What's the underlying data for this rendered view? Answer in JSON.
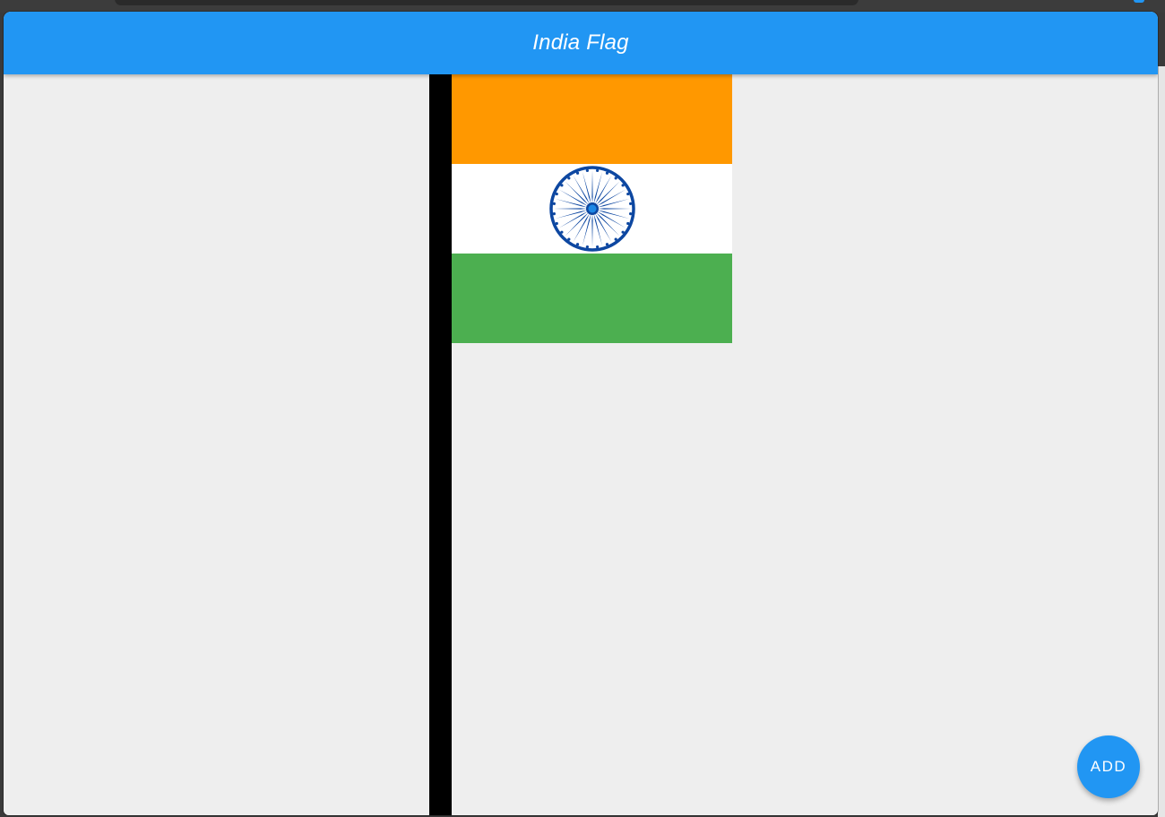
{
  "app": {
    "title": "India Flag"
  },
  "flag": {
    "colors": {
      "saffron": "#ff9800",
      "white": "#ffffff",
      "green": "#4caf50",
      "chakra": "#0d47a1",
      "pole": "#000000"
    },
    "chakra_spokes": 24
  },
  "fab": {
    "label": "ADD",
    "color": "#2196f3"
  },
  "theme": {
    "accent": "#2196f3",
    "background": "#eeeeee"
  }
}
